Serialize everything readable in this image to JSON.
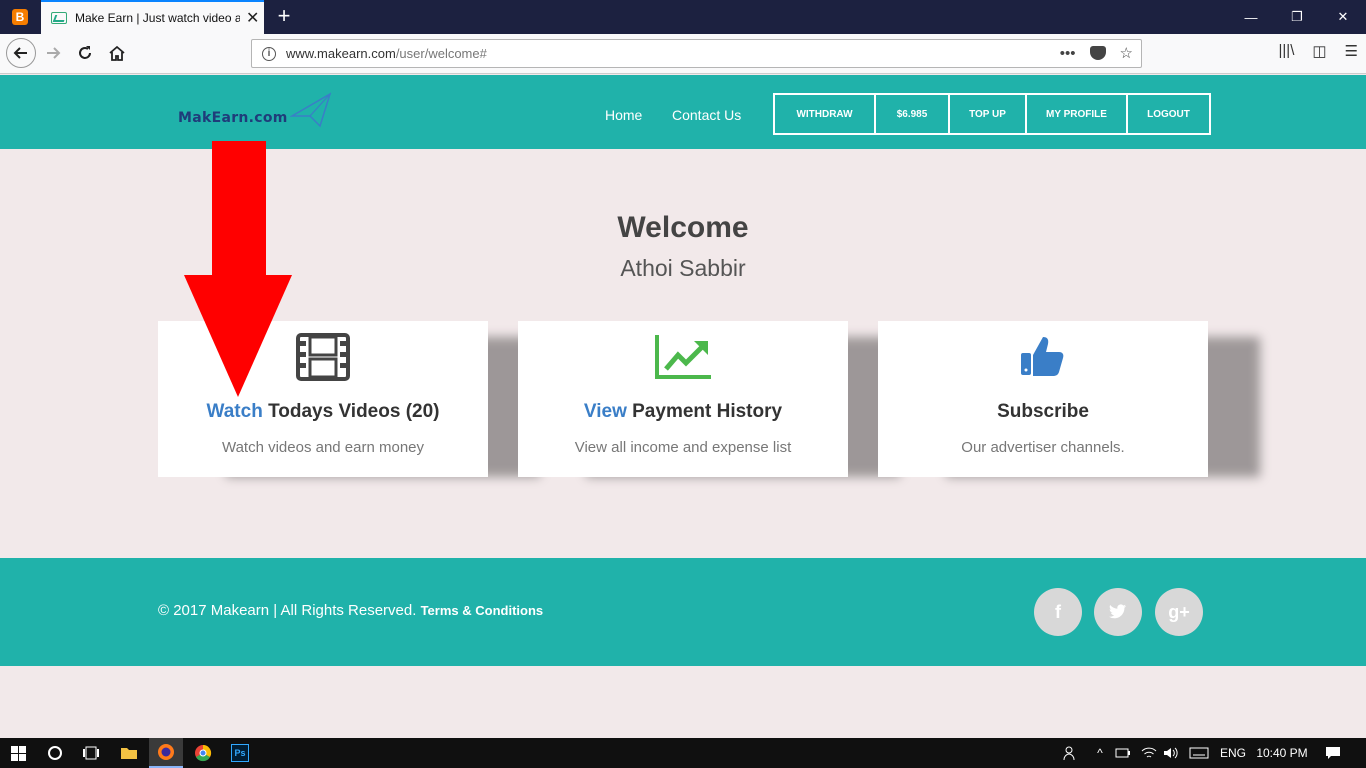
{
  "browser": {
    "tab_title": "Make Earn | Just watch video an",
    "url_domain": "www.makearn.com",
    "url_path": "/user/welcome#",
    "url_more": "•••",
    "new_tab": "+",
    "close_tab": "✕",
    "minimize": "—",
    "restore": "❐",
    "close_window": "✕",
    "library": "|||\\",
    "sidebar": "◫",
    "menu": "☰"
  },
  "site": {
    "logo_text": "MakEarn.com",
    "nav": {
      "home": "Home",
      "contact": "Contact Us"
    },
    "nav_boxes": [
      "WITHDRAW",
      "$6.985",
      "TOP UP",
      "MY PROFILE",
      "LOGOUT"
    ]
  },
  "main": {
    "welcome": "Welcome",
    "user_name": "Athoi Sabbir",
    "cards": [
      {
        "accent": "Watch",
        "title": " Todays Videos (20)",
        "subtitle": "Watch videos and earn money",
        "icon": "film-icon"
      },
      {
        "accent": "View",
        "title": " Payment History",
        "subtitle": "View all income and expense list",
        "icon": "trending-up-icon"
      },
      {
        "accent": "",
        "title": "Subscribe",
        "subtitle": "Our advertiser channels.",
        "icon": "thumbs-up-icon"
      }
    ]
  },
  "footer": {
    "copyright": "© 2017 Makearn | All Rights Reserved.",
    "terms": "Terms & Conditions",
    "social": [
      "f",
      "t",
      "g+"
    ]
  },
  "taskbar": {
    "time": "10:40 PM",
    "language": "ENG",
    "ps_label": "Ps"
  },
  "colors": {
    "teal": "#20b2aa",
    "accent_blue": "#3a7ec7",
    "arrow_red": "#ff0000",
    "chart_green": "#4cb84c"
  }
}
